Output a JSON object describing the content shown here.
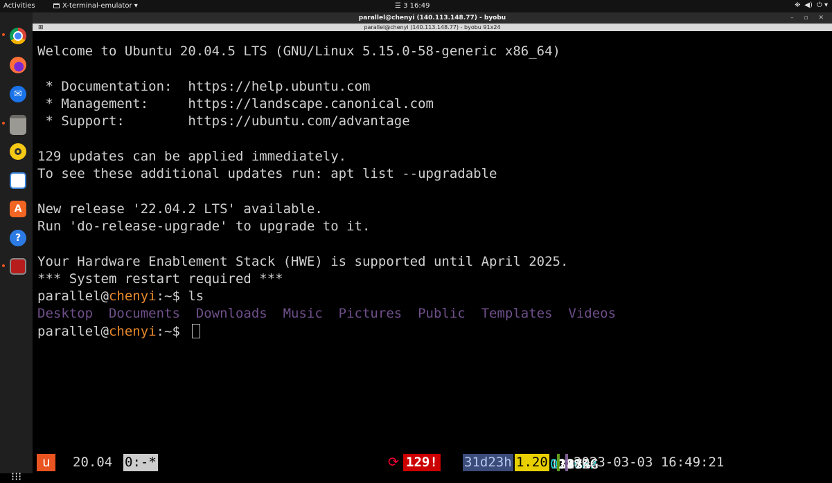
{
  "topbar": {
    "activities": "Activities",
    "app_menu": "X-terminal-emulator ▾",
    "clock": "☰ 3  16:49",
    "tray": [
      "⛯",
      "◀)",
      "⏻ ▾"
    ]
  },
  "dock": {
    "icons": [
      "chrome-icon",
      "firefox-icon",
      "thunderbird-icon",
      "files-icon",
      "rhythmbox-icon",
      "writer-icon",
      "app-center-icon",
      "help-icon",
      "terminal-icon"
    ],
    "apps_grid": "⁝⁝⁝"
  },
  "window": {
    "title": "parallel@chenyi (140.113.148.77) - byobu",
    "subtitle": "parallel@chenyi (140.113.148.77) - byobu 91x24",
    "controls": "– ▫ ✕"
  },
  "terminal": {
    "welcome": "Welcome to Ubuntu 20.04.5 LTS (GNU/Linux 5.15.0-58-generic x86_64)",
    "doc": " * Documentation:  https://help.ubuntu.com",
    "mgmt": " * Management:     https://landscape.canonical.com",
    "support": " * Support:        https://ubuntu.com/advantage",
    "updates1": "129 updates can be applied immediately.",
    "updates2": "To see these additional updates run: apt list --upgradable",
    "release1": "New release '22.04.2 LTS' available.",
    "release2": "Run 'do-release-upgrade' to upgrade to it.",
    "hwe": "Your Hardware Enablement Stack (HWE) is supported until April 2025.",
    "restart": "*** System restart required ***",
    "prompt_user": "parallel@",
    "prompt_host": "chenyi",
    "prompt_tail": ":~$ ",
    "cmd1": "ls",
    "dirs": "Desktop  Documents  Downloads  Music  Pictures  Public  Templates  Videos"
  },
  "status": {
    "u": "u",
    "version": "20.04",
    "window": "0:-*",
    "updates_icon": "⟳",
    "updates": "129!",
    "uptime": "31d23h",
    "load": "1.20",
    "cpu_count": "12x",
    "cpu_freq": "0.8GHz",
    "mem_total": "31.2G",
    "mem_pct": "19%",
    "disk_total": "234G",
    "disk_pct": "87%",
    "datetime": "2023-03-03 16:49:21"
  }
}
